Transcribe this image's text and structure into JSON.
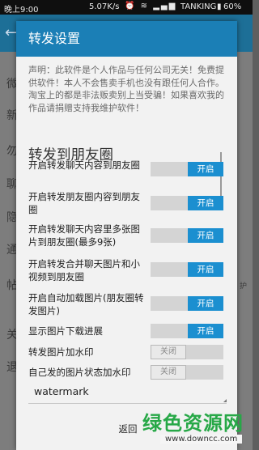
{
  "status_bar": {
    "time": "晚上9:00",
    "speed": "5.07K/s",
    "carrier": "TANKING",
    "battery": "60%"
  },
  "background": {
    "items": [
      "微",
      "新",
      "勿",
      "聊",
      "隐",
      "通",
      "帖",
      "关",
      "退"
    ],
    "right_fragment": "护"
  },
  "dialog": {
    "title": "转发设置",
    "disclaimer": "声明：此软件是个人作品与任何公司无关！免费提供软件！本人不会售卖手机也没有跟任何人合作。淘宝上的都是非法贩卖别上当受骗！如果喜欢我的作品请捐赠支持我维护软件！",
    "section_title": "转发到朋友圈",
    "settings": [
      {
        "label": "开启转发聊天内容到朋友圈",
        "state": "开启",
        "on": true
      },
      {
        "label": "开启转发朋友圈内容到朋友圈",
        "state": "开启",
        "on": true
      },
      {
        "label": "开启转发聊天内容里多张图片到朋友圈(最多9张)",
        "state": "开启",
        "on": true
      },
      {
        "label": "开启转发合并聊天图片和小视频到朋友圈",
        "state": "开启",
        "on": true
      },
      {
        "label": "开启自动加载图片(朋友圈转发图片)",
        "state": "开启",
        "on": true
      },
      {
        "label": "显示图片下载进展",
        "state": "开启",
        "on": true
      },
      {
        "label": "转发图片加水印",
        "state": "关闭",
        "on": false
      },
      {
        "label": "自己发的图片状态加水印",
        "state": "关闭",
        "on": false
      }
    ],
    "watermark_select": "watermark",
    "back_button": "返回"
  },
  "site_watermark": {
    "name": "绿色资源网",
    "url": "www.downcc.com"
  },
  "colors": {
    "accent": "#1b8fd0",
    "title_bar": "#1b7fb6",
    "watermark_green": "#27a847"
  }
}
